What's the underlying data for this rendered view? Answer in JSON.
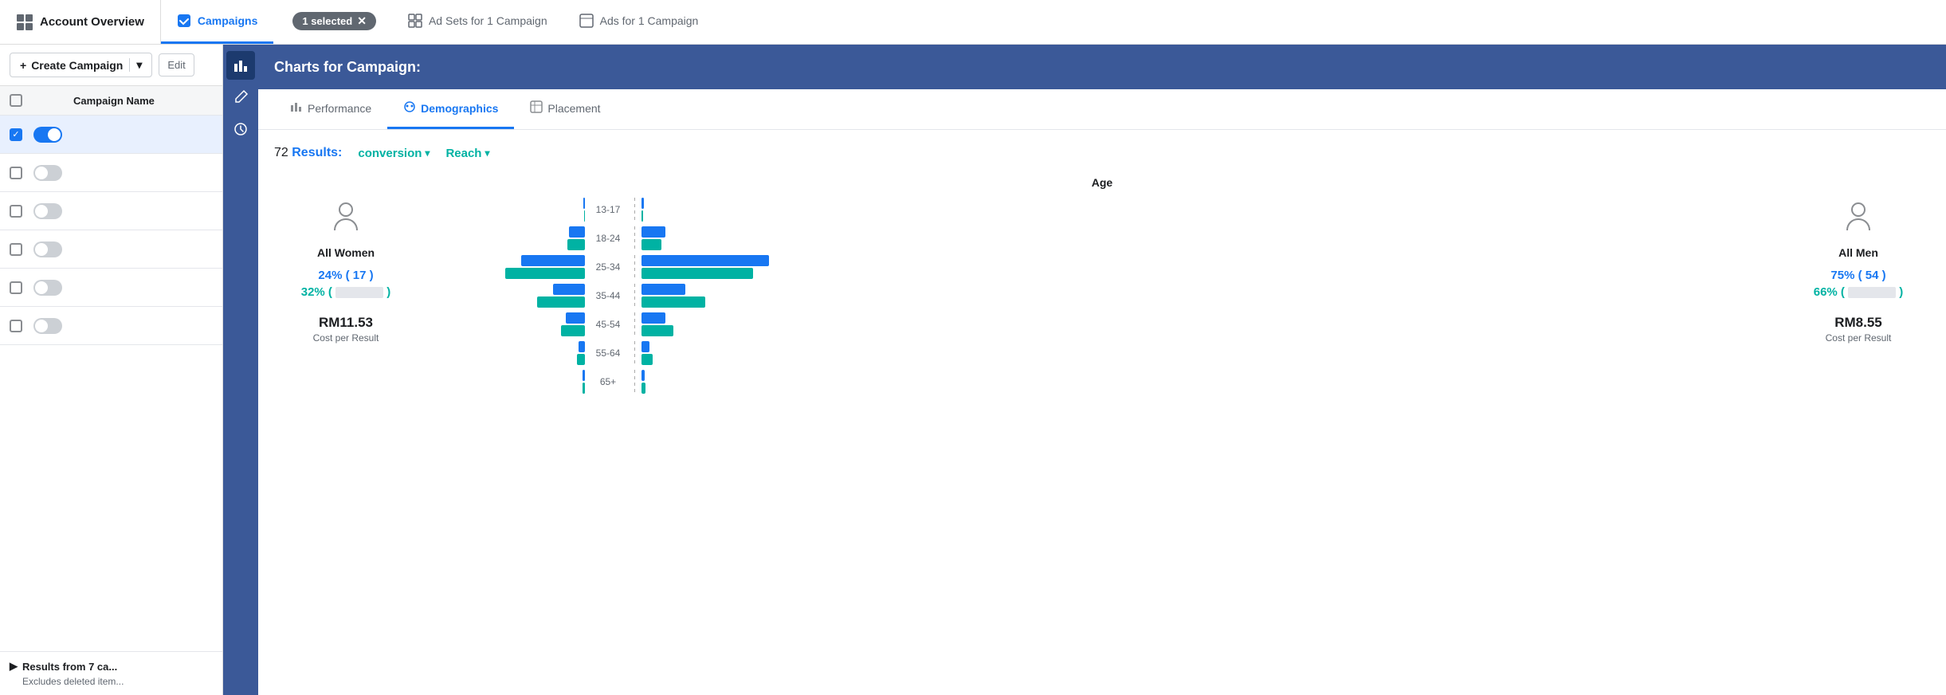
{
  "nav": {
    "account_overview": "Account Overview",
    "tab_campaigns": "Campaigns",
    "tab_adsets": "Ad Sets for 1 Campaign",
    "tab_ads": "Ads for 1 Campaign",
    "selected_badge": "1 selected"
  },
  "toolbar": {
    "create_label": "Create Campaign",
    "edit_label": "Edit"
  },
  "table": {
    "header_name": "Campaign Name",
    "rows": [
      {
        "id": 1,
        "checked": true,
        "toggle": true,
        "name": ""
      },
      {
        "id": 2,
        "checked": false,
        "toggle": false,
        "name": ""
      },
      {
        "id": 3,
        "checked": false,
        "toggle": false,
        "name": ""
      },
      {
        "id": 4,
        "checked": false,
        "toggle": false,
        "name": ""
      },
      {
        "id": 5,
        "checked": false,
        "toggle": false,
        "name": ""
      },
      {
        "id": 6,
        "checked": false,
        "toggle": false,
        "name": ""
      }
    ],
    "footer_title": "Results from 7 ca...",
    "footer_sub": "Excludes deleted item..."
  },
  "side_icons": [
    {
      "name": "bar-chart-icon",
      "glyph": "📊",
      "active": true
    },
    {
      "name": "edit-icon",
      "glyph": "✎",
      "active": false
    },
    {
      "name": "history-icon",
      "glyph": "🕐",
      "active": false
    }
  ],
  "charts": {
    "header": "Charts for Campaign:",
    "tabs": [
      {
        "name": "performance-tab",
        "label": "Performance",
        "active": false
      },
      {
        "name": "demographics-tab",
        "label": "Demographics",
        "active": true
      },
      {
        "name": "placement-tab",
        "label": "Placement",
        "active": false
      }
    ],
    "results_count": "72",
    "results_label": "Results:",
    "conversion_label": "conversion",
    "reach_label": "Reach",
    "age_header": "Age",
    "age_groups": [
      "13-17",
      "18-24",
      "25-34",
      "35-44",
      "45-54",
      "55-64",
      "65+"
    ],
    "women": {
      "label": "All Women",
      "pct_stat": "24% ( 17 )",
      "reach_stat": "32% (",
      "reach_stat2": ")",
      "cost": "RM11.53",
      "cost_label": "Cost per Result"
    },
    "men": {
      "label": "All Men",
      "pct_stat": "75% ( 54 )",
      "reach_stat": "66% (",
      "reach_stat2": ")",
      "cost": "RM8.55",
      "cost_label": "Cost per Result"
    },
    "bars": {
      "women_blue": [
        2,
        20,
        80,
        40,
        24,
        8,
        3
      ],
      "women_teal": [
        1,
        22,
        100,
        60,
        30,
        10,
        3
      ],
      "men_blue": [
        3,
        30,
        160,
        55,
        30,
        10,
        4
      ],
      "men_teal": [
        2,
        25,
        140,
        80,
        40,
        14,
        5
      ]
    }
  }
}
